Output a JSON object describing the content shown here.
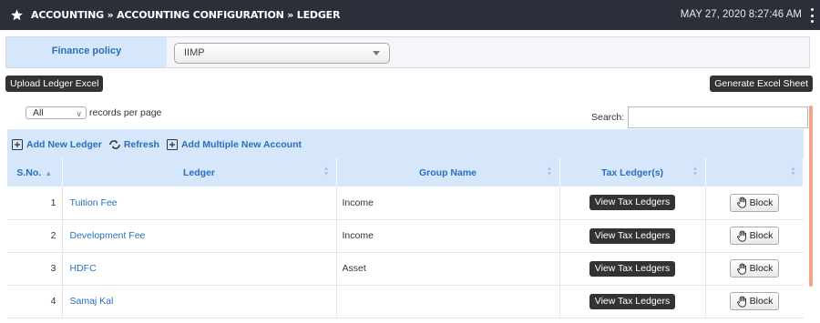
{
  "header": {
    "breadcrumb": "ACCOUNTING » ACCOUNTING CONFIGURATION » LEDGER",
    "datetime": "MAY 27, 2020  8:27:46 AM",
    "star_icon": "star-icon",
    "menu_icon": "kebab-menu-icon"
  },
  "policy": {
    "label": "Finance policy",
    "selected": "IIMP"
  },
  "buttons": {
    "upload": "Upload Ledger Excel",
    "generate": "Generate Excel Sheet"
  },
  "length": {
    "selected": "All",
    "suffix": "records per page"
  },
  "search": {
    "label": "Search:",
    "value": ""
  },
  "toolbar": {
    "add_new": "Add New Ledger",
    "refresh": "Refresh",
    "add_multiple": "Add Multiple New Account"
  },
  "table": {
    "columns": [
      "S.No.",
      "Ledger",
      "Group Name",
      "Tax Ledger(s)",
      ""
    ],
    "rows": [
      {
        "sno": "1",
        "ledger": "Tuition Fee",
        "group": "Income",
        "tax_button": "View Tax Ledgers",
        "action": "Block"
      },
      {
        "sno": "2",
        "ledger": "Development Fee",
        "group": "Income",
        "tax_button": "View Tax Ledgers",
        "action": "Block"
      },
      {
        "sno": "3",
        "ledger": "HDFC",
        "group": "Asset",
        "tax_button": "View Tax Ledgers",
        "action": "Block"
      },
      {
        "sno": "4",
        "ledger": "Samaj Kal",
        "group": "",
        "tax_button": "View Tax Ledgers",
        "action": "Block"
      }
    ]
  },
  "colors": {
    "header_bg": "#2b2f3a",
    "accent_blue": "#2a6ebb",
    "light_blue": "#d6e7fb",
    "scrollbar": "#f0a58c"
  }
}
